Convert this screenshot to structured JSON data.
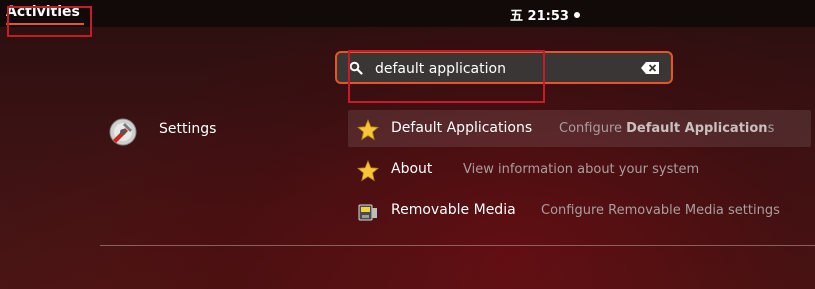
{
  "topbar": {
    "activities_label": "Activities",
    "clock": "五 21:53"
  },
  "search": {
    "value": "default application"
  },
  "provider": {
    "label": "Settings",
    "icon": "settings-icon"
  },
  "results": [
    {
      "title": "Default Applications",
      "description_prefix": "Configure ",
      "description_bold": "Default Application",
      "description_suffix": "s",
      "icon": "star-icon"
    },
    {
      "title": "About",
      "description": "View information about your system",
      "icon": "star-icon"
    },
    {
      "title": "Removable Media",
      "description": "Configure Removable Media settings",
      "icon": "removable-media-icon"
    }
  ],
  "colors": {
    "accent": "#e95420",
    "annotation": "#c41d27"
  }
}
